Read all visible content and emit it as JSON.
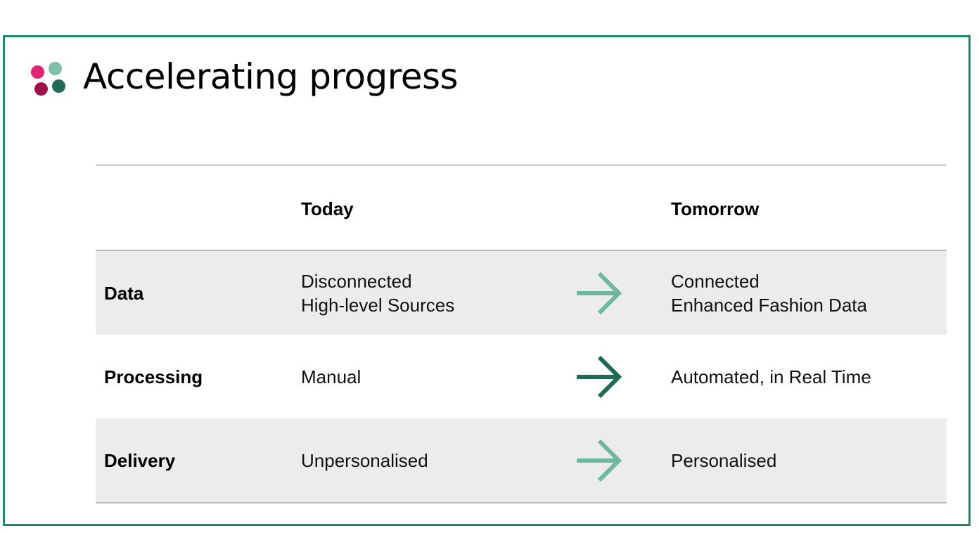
{
  "slide": {
    "title": "Accelerating progress",
    "colors": {
      "frame": "#1a8c6a",
      "logo_dots": [
        "#e0246f",
        "#7fbfa9",
        "#a01048",
        "#1f6b55"
      ],
      "arrow_light": "#6fb8a0",
      "arrow_dark": "#1f6b55",
      "row_shade": "#ececec"
    }
  },
  "table": {
    "headers": {
      "today": "Today",
      "tomorrow": "Tomorrow"
    },
    "rows": [
      {
        "label": "Data",
        "today": "Disconnected\nHigh-level Sources",
        "tomorrow": "Connected\nEnhanced Fashion Data",
        "arrow_icon": "arrow-right-light"
      },
      {
        "label": "Processing",
        "today": "Manual",
        "tomorrow": "Automated, in Real Time",
        "arrow_icon": "arrow-right-dark"
      },
      {
        "label": "Delivery",
        "today": "Unpersonalised",
        "tomorrow": "Personalised",
        "arrow_icon": "arrow-right-light"
      }
    ]
  }
}
